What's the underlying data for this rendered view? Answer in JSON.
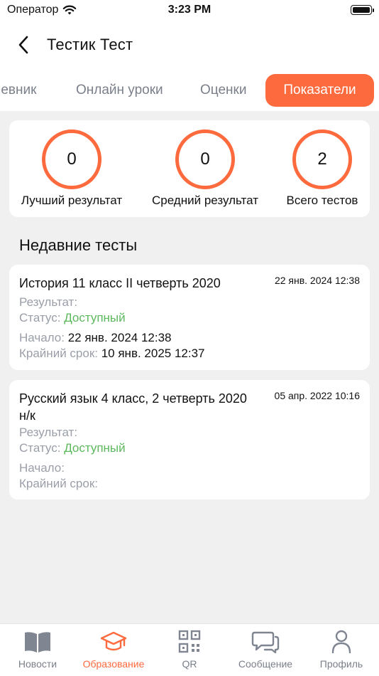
{
  "status_bar": {
    "carrier": "Оператор",
    "time": "3:23 PM"
  },
  "nav": {
    "title": "Тестик Тест"
  },
  "tabs": [
    {
      "label": "Дневник"
    },
    {
      "label": "Онлайн уроки"
    },
    {
      "label": "Оценки"
    },
    {
      "label": "Показатели"
    }
  ],
  "stats": [
    {
      "value": "0",
      "label": "Лучший результат"
    },
    {
      "value": "0",
      "label": "Средний результат"
    },
    {
      "value": "2",
      "label": "Всего тестов"
    }
  ],
  "recent": {
    "title": "Недавние тесты",
    "items": [
      {
        "name": "История 11 класс II четверть 2020",
        "date": "22 янв. 2024 12:38",
        "result_label": "Результат:",
        "result_value": "",
        "status_label": "Статус:",
        "status_value": "Доступный",
        "start_label": "Начало:",
        "start_value": "22 янв. 2024 12:38",
        "deadline_label": "Крайний срок:",
        "deadline_value": "10 янв. 2025 12:37"
      },
      {
        "name": "Русский язык 4 класс, 2 четверть 2020 н/к",
        "date": "05 апр. 2022 10:16",
        "result_label": "Результат:",
        "result_value": "",
        "status_label": "Статус:",
        "status_value": "Доступный",
        "start_label": "Начало:",
        "start_value": "",
        "deadline_label": "Крайний срок:",
        "deadline_value": ""
      }
    ]
  },
  "tabbar": [
    {
      "label": "Новости",
      "icon": "book-icon"
    },
    {
      "label": "Образование",
      "icon": "graduation-cap-icon"
    },
    {
      "label": "QR",
      "icon": "qr-code-icon"
    },
    {
      "label": "Сообщение",
      "icon": "chat-icon"
    },
    {
      "label": "Профиль",
      "icon": "person-icon"
    }
  ],
  "colors": {
    "accent": "#fd6a3e",
    "status_ok": "#5cb85c",
    "muted": "#9a9ea8"
  }
}
